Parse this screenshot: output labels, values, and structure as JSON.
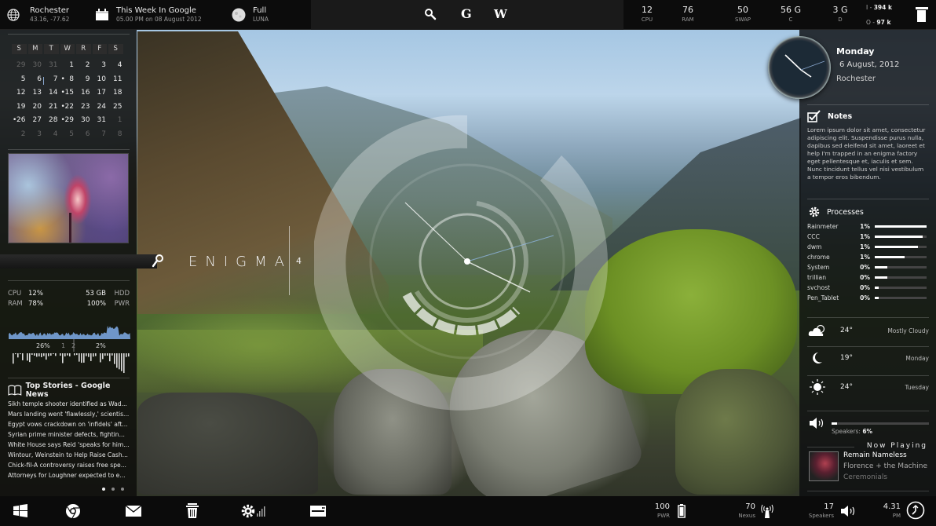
{
  "topbar": {
    "location": {
      "icon": "globe-icon",
      "title": "Rochester",
      "subtitle": "43.16, -77.62"
    },
    "calendar_event": {
      "icon": "calendar-icon",
      "title": "This Week In Google",
      "subtitle": "05.00 PM on 08 August 2012"
    },
    "moon": {
      "icon": "moon-icon",
      "title": "Full",
      "subtitle": "LUNA"
    },
    "search_buttons": [
      {
        "icon": "search-icon",
        "label": ""
      },
      {
        "icon": "google-icon",
        "label": "G"
      },
      {
        "icon": "wikipedia-icon",
        "label": "W"
      }
    ],
    "stats": [
      {
        "value": "12",
        "label": "CPU"
      },
      {
        "value": "76",
        "label": "RAM"
      },
      {
        "value": "50",
        "label": "SWAP"
      },
      {
        "value": "56 G",
        "label": "C"
      },
      {
        "value": "3 G",
        "label": "D"
      }
    ],
    "network": {
      "in_label": "I - ",
      "in_value": "394 k",
      "out_label": "O - ",
      "out_value": "97 k"
    },
    "recycle_icon": "recycle-bin-icon"
  },
  "calendar": {
    "headers": [
      "S",
      "M",
      "T",
      "W",
      "R",
      "F",
      "S"
    ],
    "weeks": [
      [
        {
          "d": "29",
          "dim": true
        },
        {
          "d": "30",
          "dim": true
        },
        {
          "d": "31",
          "dim": true
        },
        {
          "d": "1"
        },
        {
          "d": "2"
        },
        {
          "d": "3"
        },
        {
          "d": "4"
        }
      ],
      [
        {
          "d": "5"
        },
        {
          "d": "6",
          "today": true
        },
        {
          "d": "7"
        },
        {
          "d": "8",
          "event": true
        },
        {
          "d": "9"
        },
        {
          "d": "10"
        },
        {
          "d": "11"
        }
      ],
      [
        {
          "d": "12"
        },
        {
          "d": "13"
        },
        {
          "d": "14"
        },
        {
          "d": "15",
          "event": true
        },
        {
          "d": "16"
        },
        {
          "d": "17"
        },
        {
          "d": "18"
        }
      ],
      [
        {
          "d": "19"
        },
        {
          "d": "20"
        },
        {
          "d": "21"
        },
        {
          "d": "22",
          "event": true
        },
        {
          "d": "23"
        },
        {
          "d": "24"
        },
        {
          "d": "25"
        }
      ],
      [
        {
          "d": "26",
          "event": true
        },
        {
          "d": "27"
        },
        {
          "d": "28"
        },
        {
          "d": "29",
          "event": true
        },
        {
          "d": "30"
        },
        {
          "d": "31"
        },
        {
          "d": "1",
          "dim": true
        }
      ],
      [
        {
          "d": "2",
          "dim": true
        },
        {
          "d": "3",
          "dim": true
        },
        {
          "d": "4",
          "dim": true
        },
        {
          "d": "5",
          "dim": true
        },
        {
          "d": "6",
          "dim": true
        },
        {
          "d": "7",
          "dim": true
        },
        {
          "d": "8",
          "dim": true
        }
      ]
    ]
  },
  "launcher": {
    "title": "ENIGMA",
    "version": "4",
    "search_icon": "search-icon"
  },
  "system": {
    "cpu_label": "CPU",
    "cpu_value": "12%",
    "ram_label": "RAM",
    "ram_value": "78%",
    "hdd_value": "53 GB",
    "hdd_label": "HDD",
    "pwr_value": "100%",
    "pwr_label": "PWR",
    "core1_value": "26%",
    "core1_label": "1",
    "core2_label": "2",
    "core2_value": "2%"
  },
  "news": {
    "title": "Top Stories - Google News",
    "items": [
      "Sikh temple shooter identified as Wad...",
      "Mars landing went 'flawlessly,' scientis...",
      "Egypt vows crackdown on 'infidels' aft...",
      "Syrian prime minister defects, fightin...",
      "White House says Reid 'speaks for him...",
      "Wintour, Weinstein to Help Raise Cash...",
      "Chick-fil-A controversy raises free spe...",
      "Attorneys for Loughner expected to e..."
    ],
    "page": 1,
    "pages": 3
  },
  "date_widget": {
    "weekday": "Monday",
    "date": "6 August, 2012",
    "city": "Rochester"
  },
  "notes": {
    "title": "Notes",
    "body": "Lorem ipsum dolor sit amet, consectetur adipiscing elit. Suspendisse purus nulla, dapibus sed eleifend sit amet, laoreet et help I'm trapped in an enigma factory eget pellentesque et, iaculis et sem. Nunc tincidunt tellus vel nisi vestibulum a tempor eros bibendum."
  },
  "processes": {
    "title": "Processes",
    "items": [
      {
        "name": "Rainmeter",
        "pct": "1%",
        "bar": 1.0
      },
      {
        "name": "CCC",
        "pct": "1%",
        "bar": 0.92
      },
      {
        "name": "dwm",
        "pct": "1%",
        "bar": 0.84
      },
      {
        "name": "chrome",
        "pct": "1%",
        "bar": 0.58
      },
      {
        "name": "System",
        "pct": "0%",
        "bar": 0.24
      },
      {
        "name": "trillian",
        "pct": "0%",
        "bar": 0.24
      },
      {
        "name": "svchost",
        "pct": "0%",
        "bar": 0.08
      },
      {
        "name": "Pen_Tablet",
        "pct": "0%",
        "bar": 0.08
      }
    ]
  },
  "weather": [
    {
      "icon": "partly-cloudy-icon",
      "temp": "24°",
      "desc": "Mostly Cloudy"
    },
    {
      "icon": "moon-icon",
      "temp": "19°",
      "desc": "Monday"
    },
    {
      "icon": "sun-icon",
      "temp": "24°",
      "desc": "Tuesday"
    }
  ],
  "volume": {
    "label": "Speakers: ",
    "value": "6%",
    "level": 0.06
  },
  "now_playing": {
    "title": "Now Playing",
    "song": "Remain Nameless",
    "artist": "Florence + the Machine",
    "album": "Ceremonials"
  },
  "bottombar": {
    "launchers": [
      "windows-icon",
      "chrome-icon",
      "mail-icon",
      "trash-icon",
      "settings-icon",
      "drive-icon"
    ],
    "battery": {
      "value": "100",
      "label": "PWR"
    },
    "wifi": {
      "value": "70",
      "label": "Nexus"
    },
    "speakers": {
      "value": "17",
      "label": "Speakers"
    },
    "time": {
      "value": "4.31",
      "label": "PM"
    }
  }
}
